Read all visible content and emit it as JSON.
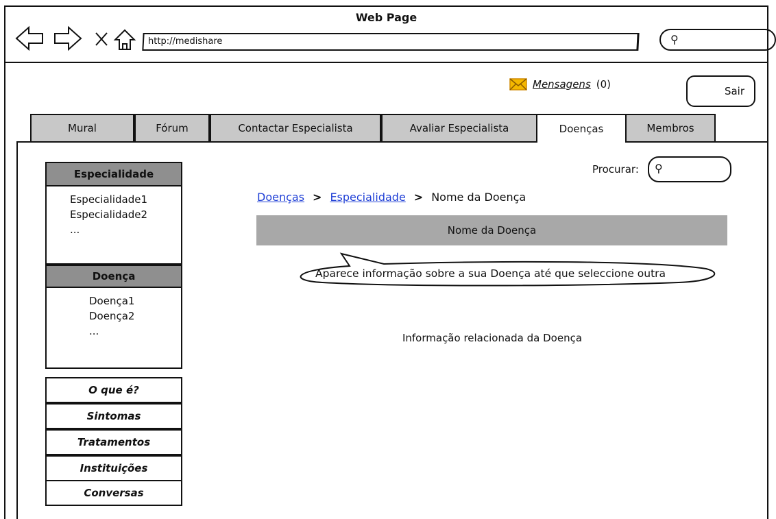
{
  "window": {
    "title": "Web Page"
  },
  "browser": {
    "url": "http://medishare"
  },
  "header": {
    "messages_label": "Mensagens",
    "messages_count": "(0)",
    "logout_label": "Sair"
  },
  "tabs": [
    {
      "label": "Mural"
    },
    {
      "label": "Fórum"
    },
    {
      "label": "Contactar Especialista"
    },
    {
      "label": "Avaliar Especialista"
    },
    {
      "label": "Doenças",
      "active": true
    },
    {
      "label": "Membros"
    }
  ],
  "sidebar": {
    "specialty": {
      "title": "Especialidade",
      "items": [
        "Especialidade1",
        "Especialidade2",
        "..."
      ]
    },
    "disease": {
      "title": "Doença",
      "items": [
        "Doença1",
        "Doença2",
        "..."
      ]
    },
    "menu": [
      "O que é?",
      "Sintomas",
      "Tratamentos",
      "Instituições",
      "Conversas"
    ]
  },
  "search": {
    "label": "Procurar:"
  },
  "breadcrumb": {
    "items": [
      "Doenças",
      "Especialidade",
      "Nome da Doença"
    ],
    "separator": ">"
  },
  "content": {
    "title": "Nome da Doença",
    "callout": "Aparece informação sobre a sua Doença até que seleccione outra",
    "info": "Informação relacionada da Doença"
  }
}
